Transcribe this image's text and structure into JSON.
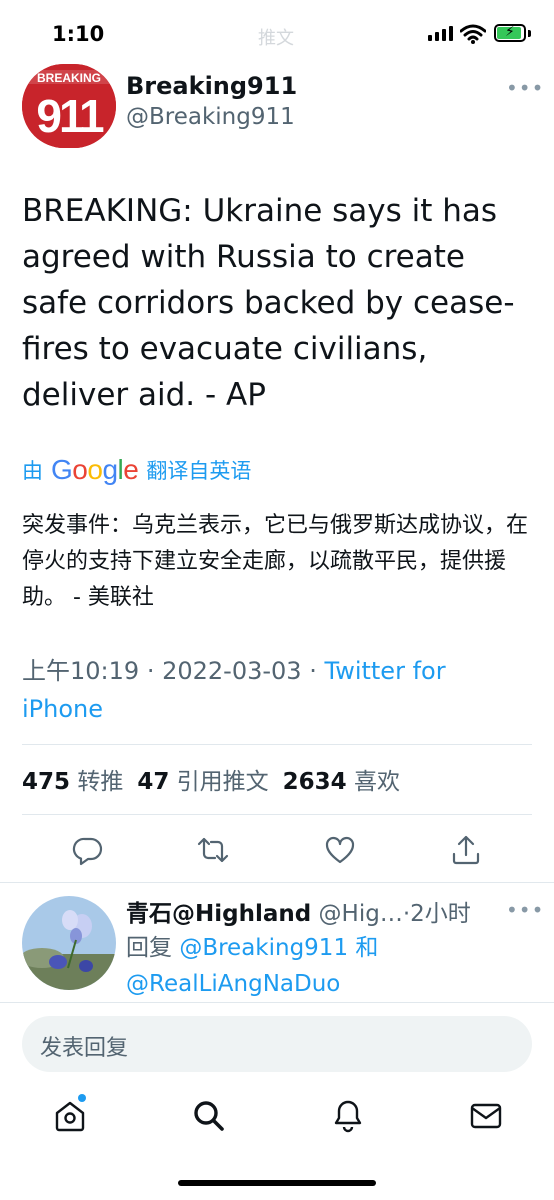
{
  "status_bar": {
    "time": "1:10",
    "faded_title": "推文"
  },
  "tweet": {
    "author_name": "Breaking911",
    "author_handle": "@Breaking911",
    "avatar_text": "911",
    "avatar_banner": "BREAKING",
    "more_icon": "more-horizontal-icon",
    "text": "BREAKING: Ukraine says it has agreed with Russia to create safe corridors backed by cease-fires to evacuate civilians, deliver aid. - AP",
    "translate_prefix": "由",
    "translate_brand": "Google",
    "translate_suffix": "翻译自英语",
    "translated_text": "突发事件：乌克兰表示，它已与俄罗斯达成协议，在停火的支持下建立安全走廊，以疏散平民，提供援助。 - 美联社",
    "time": "上午10:19",
    "date": "2022-03-03",
    "source": "Twitter for iPhone",
    "separator": "·"
  },
  "stats": {
    "retweets_count": "475",
    "retweets_label": "转推",
    "quotes_count": "47",
    "quotes_label": "引用推文",
    "likes_count": "2634",
    "likes_label": "喜欢"
  },
  "actions": [
    "reply-icon",
    "retweet-icon",
    "like-icon",
    "share-icon"
  ],
  "reply": {
    "name": "青石@Highland",
    "handle": "@Hig…",
    "time": "·2小时",
    "prefix": "回复",
    "mention1": "@Breaking911",
    "conjunction": "和",
    "mention2": "@RealLiAngNaDuo"
  },
  "compose": {
    "placeholder": "发表回复"
  },
  "tab_bar": {
    "items": [
      "home-icon",
      "search-icon",
      "notifications-icon",
      "messages-icon"
    ]
  },
  "colors": {
    "accent": "#1d9bf0",
    "text": "#0f1419",
    "secondary": "#536471",
    "avatar_red": "#c8242b"
  }
}
